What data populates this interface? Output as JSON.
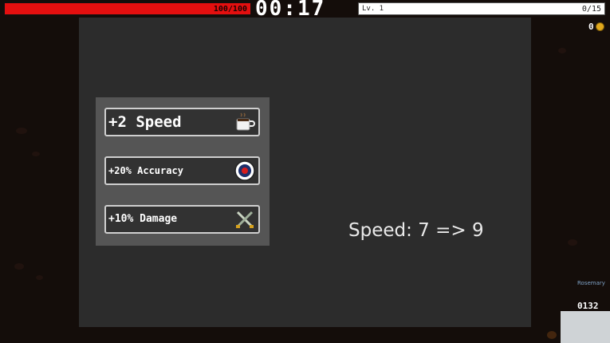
{
  "hud": {
    "health": {
      "text": "100/100",
      "fraction": 1.0,
      "color": "#e40f0f"
    },
    "timer": "00:17",
    "xp": {
      "label": "Lv. 1",
      "text": "0/15",
      "fraction": 0.0
    },
    "coins": "0",
    "name_tag": "Rosemary",
    "kill_count": "0132"
  },
  "levelup": {
    "choices": [
      {
        "label": "+2 Speed",
        "icon": "coffee-cup-icon"
      },
      {
        "label": "+20% Accuracy",
        "icon": "target-icon"
      },
      {
        "label": "+10% Damage",
        "icon": "crossed-swords-icon"
      }
    ],
    "stat_change": "Speed: 7 => 9"
  },
  "colors": {
    "panel": "#2c2c2c",
    "choices_frame": "#555555",
    "health": "#e40f0f",
    "coin": "#e1a81c"
  }
}
